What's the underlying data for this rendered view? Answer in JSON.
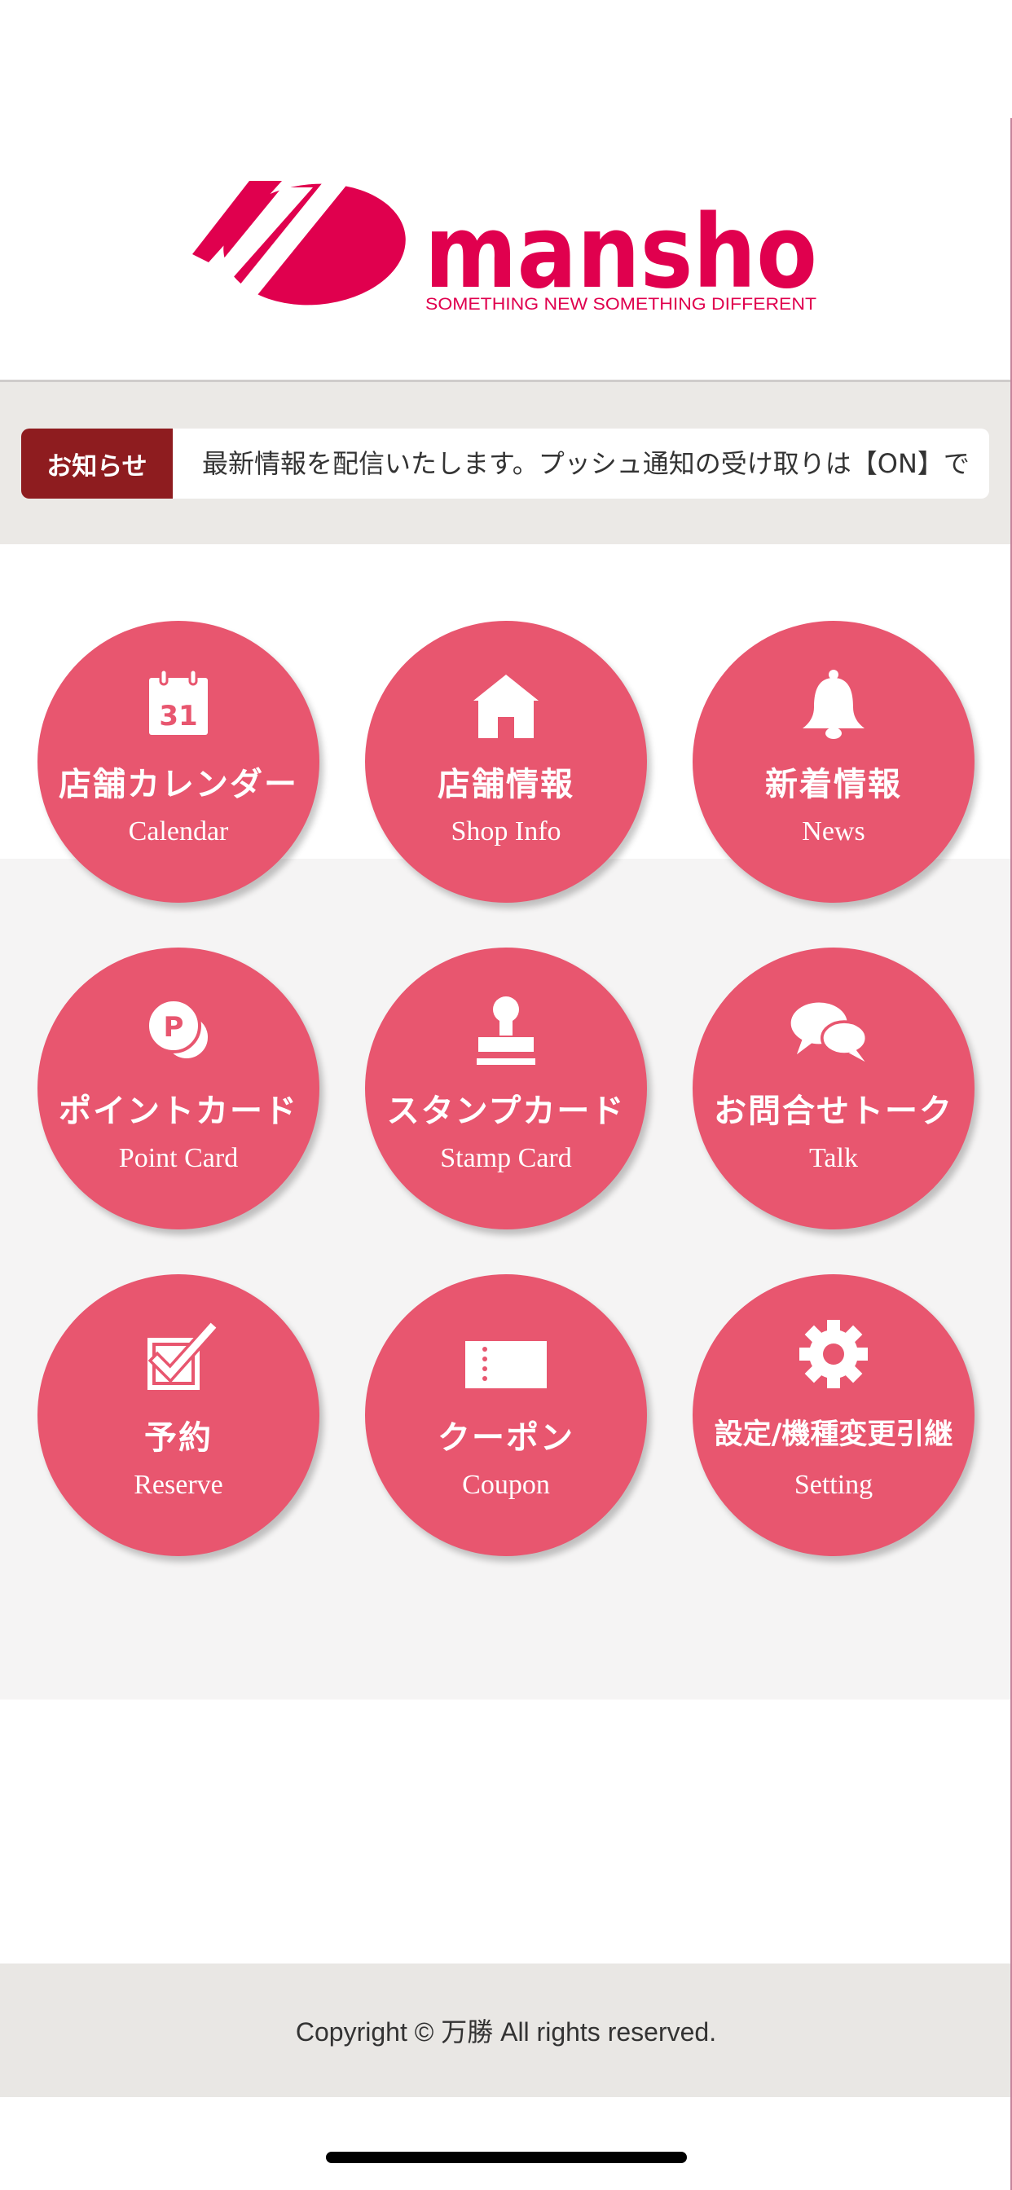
{
  "brand": {
    "name": "mansho",
    "tagline": "SOMETHING NEW SOMETHING DIFFERENT",
    "color": "#e0004e"
  },
  "notice": {
    "label": "お知らせ",
    "text": "最新情報を配信いたします。プッシュ通知の受け取りは【ON】で"
  },
  "menu": [
    {
      "jp": "店舗カレンダー",
      "en": "Calendar",
      "icon": "calendar-icon",
      "icon_text": "31"
    },
    {
      "jp": "店舗情報",
      "en": "Shop Info",
      "icon": "house-icon"
    },
    {
      "jp": "新着情報",
      "en": "News",
      "icon": "bell-icon"
    },
    {
      "jp": "ポイントカード",
      "en": "Point Card",
      "icon": "point-coin-icon",
      "icon_text": "P"
    },
    {
      "jp": "スタンプカード",
      "en": "Stamp Card",
      "icon": "stamp-icon"
    },
    {
      "jp": "お問合せトーク",
      "en": "Talk",
      "icon": "chat-bubbles-icon"
    },
    {
      "jp": "予約",
      "en": "Reserve",
      "icon": "checkbox-icon"
    },
    {
      "jp": "クーポン",
      "en": "Coupon",
      "icon": "ticket-icon"
    },
    {
      "jp": "設定/機種変更引継",
      "en": "Setting",
      "icon": "gear-icon"
    }
  ],
  "footer": {
    "copyright": "Copyright © 万勝 All rights reserved."
  },
  "colors": {
    "button": "#e8566f",
    "notice_label_bg": "#8e1c1f",
    "notice_area_bg": "#ebe9e6",
    "grid_bg": "#f5f4f4",
    "footer_bg": "#e9e7e4"
  }
}
